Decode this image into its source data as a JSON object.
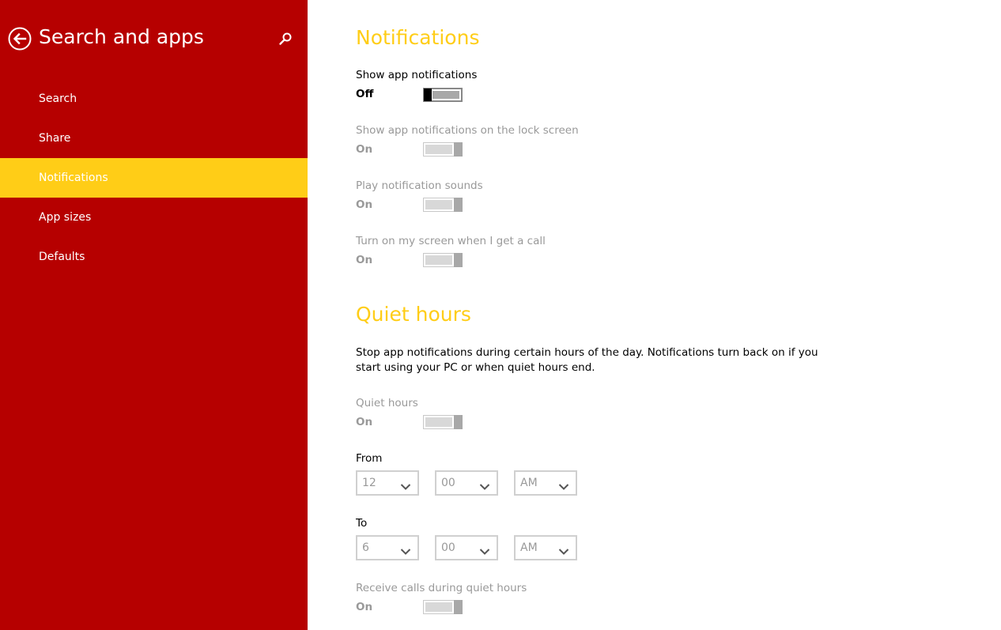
{
  "sidebar": {
    "title": "Search and apps",
    "items": [
      {
        "label": "Search"
      },
      {
        "label": "Share"
      },
      {
        "label": "Notifications"
      },
      {
        "label": "App sizes"
      },
      {
        "label": "Defaults"
      }
    ],
    "active_item": "Notifications"
  },
  "notifications": {
    "title": "Notifications",
    "settings": [
      {
        "label": "Show app notifications",
        "state": "Off",
        "enabled": true
      },
      {
        "label": "Show app notifications on the lock screen",
        "state": "On",
        "enabled": false
      },
      {
        "label": "Play notification sounds",
        "state": "On",
        "enabled": false
      },
      {
        "label": "Turn on my screen when I get a call",
        "state": "On",
        "enabled": false
      }
    ]
  },
  "quiet_hours": {
    "title": "Quiet hours",
    "description": "Stop app notifications during certain hours of the day. Notifications turn back on if you start using your PC or when quiet hours end.",
    "toggle": {
      "label": "Quiet hours",
      "state": "On"
    },
    "from": {
      "label": "From",
      "hour": "12",
      "minute": "00",
      "period": "AM"
    },
    "to": {
      "label": "To",
      "hour": "6",
      "minute": "00",
      "period": "AM"
    },
    "receive_calls": {
      "label": "Receive calls during quiet hours",
      "state": "On"
    }
  },
  "colors": {
    "sidebar_bg": "#b60000",
    "accent": "#ffcd17",
    "disabled_text": "#999999"
  },
  "icons": {
    "back": "back-arrow-icon",
    "search": "search-icon",
    "dropdown": "chevron-down-icon"
  }
}
